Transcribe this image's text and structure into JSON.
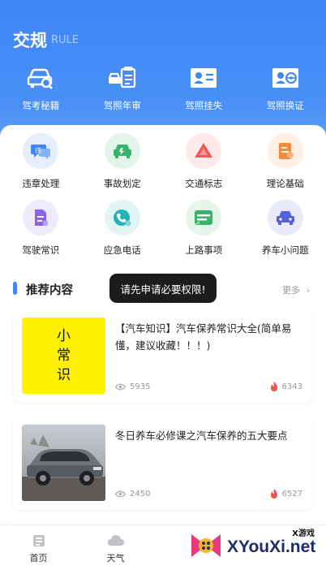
{
  "header": {
    "title": "交规",
    "subtitle": "RULE"
  },
  "top_nav": [
    {
      "label": "驾考秘籍",
      "icon": "car-search-icon"
    },
    {
      "label": "驾照年审",
      "icon": "license-review-icon"
    },
    {
      "label": "驾照挂失",
      "icon": "id-card-icon"
    },
    {
      "label": "驾照换证",
      "icon": "license-renew-icon"
    }
  ],
  "grid": [
    {
      "label": "违章处理",
      "icon": "violation-chat-icon",
      "bg": "#e6eefc",
      "fg": "#3f86f6"
    },
    {
      "label": "事故划定",
      "icon": "accident-car-icon",
      "bg": "#e3f5ea",
      "fg": "#36b46a"
    },
    {
      "label": "交通标志",
      "icon": "traffic-sign-icon",
      "bg": "#fde9ea",
      "fg": "#ec5a5a"
    },
    {
      "label": "理论基础",
      "icon": "theory-book-icon",
      "bg": "#fdefe3",
      "fg": "#f08a3c"
    },
    {
      "label": "驾驶常识",
      "icon": "driving-doc-icon",
      "bg": "#efeafd",
      "fg": "#8a64e8"
    },
    {
      "label": "应急电话",
      "icon": "emergency-phone-icon",
      "bg": "#e3f4f5",
      "fg": "#21b3b7"
    },
    {
      "label": "上路事项",
      "icon": "road-notes-icon",
      "bg": "#e5f5ea",
      "fg": "#3ab26a"
    },
    {
      "label": "养车小问题",
      "icon": "car-care-icon",
      "bg": "#e9ebfb",
      "fg": "#5561d8"
    }
  ],
  "section": {
    "title": "推荐内容",
    "more": "更多"
  },
  "toast": "请先申请必要权限!",
  "posts": [
    {
      "title": "【汽车知识】汽车保养常识大全(简单易懂，建议收藏！！！)",
      "thumb_text": [
        "小",
        "常",
        "识"
      ],
      "views": "5935",
      "hot": "6343"
    },
    {
      "title": "冬日养车必修课之汽车保养的五大要点",
      "views": "2450",
      "hot": "6527"
    }
  ],
  "tabbar": [
    {
      "label": "首页",
      "icon": "home-icon"
    },
    {
      "label": "天气",
      "icon": "weather-cloud-icon"
    }
  ],
  "watermark": {
    "text": "XYouXi.net",
    "tag": "X游戏"
  },
  "colors": {
    "accent": "#3f86f6",
    "hot": "#f05454"
  }
}
